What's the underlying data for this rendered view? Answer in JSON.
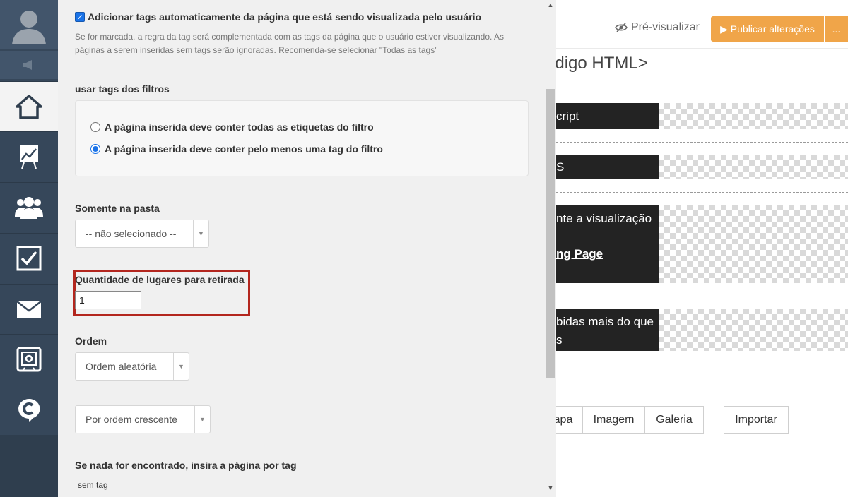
{
  "sidebar": {
    "items": [
      {
        "name": "home-icon"
      },
      {
        "name": "chart-icon"
      },
      {
        "name": "users-icon"
      },
      {
        "name": "checkbox-icon"
      },
      {
        "name": "mail-icon"
      },
      {
        "name": "safe-icon"
      },
      {
        "name": "logo-c-icon"
      }
    ],
    "active_index": 0
  },
  "panel": {
    "auto_tags_label": "Adicionar tags automaticamente da página que está sendo visualizada pelo usuário",
    "auto_tags_checked": true,
    "auto_tags_help_1": "Se for marcada, a regra da tag será complementada com as tags da página que o usuário estiver visualizando. As",
    "auto_tags_help_2": "páginas a serem inseridas sem tags serão ignoradas. Recomenda-se selecionar \"Todas as tags\"",
    "filter_tags_label": "usar tags dos filtros",
    "radio_all": "A página inserida deve conter todas as etiquetas do filtro",
    "radio_any": "A página inserida deve conter pelo menos uma tag do filtro",
    "folder_label": "Somente na pasta",
    "folder_value": "-- não selecionado --",
    "qty_label": "Quantidade de lugares para retirada",
    "qty_value": "1",
    "order_label": "Ordem",
    "order_value": "Ordem aleatória",
    "sort_value": "Por ordem crescente",
    "fallback_label": "Se nada for encontrado, insira a página por tag",
    "fallback_value": "sem tag"
  },
  "editor": {
    "preview_label": "Pré-visualizar",
    "publish_label": "▶ Publicar alterações",
    "more_label": "...",
    "heading": "ódigo HTML>",
    "block1": "cript",
    "block2": "S",
    "block3_line1": "nte a visualização",
    "block3_line2": "ng Page",
    "block4_line1": "bidas mais do que",
    "block4_line2": "s",
    "btn_capa": "apa",
    "btn_imagem": "Imagem",
    "btn_galeria": "Galeria",
    "btn_importar": "Importar"
  },
  "colors": {
    "sidebar": "#36475a",
    "accent": "#f0a549",
    "highlight": "#b3261e"
  }
}
